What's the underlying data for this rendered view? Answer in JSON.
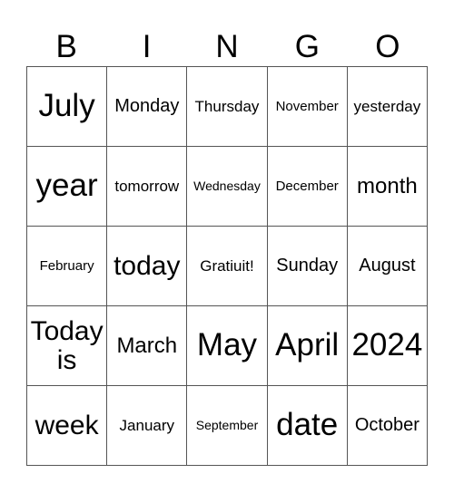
{
  "header": {
    "letters": [
      "B",
      "I",
      "N",
      "G",
      "O"
    ]
  },
  "grid": {
    "cells": [
      [
        "July",
        "Monday",
        "Thursday",
        "November",
        "yesterday"
      ],
      [
        "year",
        "tomorrow",
        "Wednesday",
        "December",
        "month"
      ],
      [
        "February",
        "today",
        "Gratiuit!",
        "Sunday",
        "August"
      ],
      [
        "Today is",
        "March",
        "May",
        "April",
        "2024"
      ],
      [
        "week",
        "January",
        "September",
        "date",
        "October"
      ]
    ]
  }
}
